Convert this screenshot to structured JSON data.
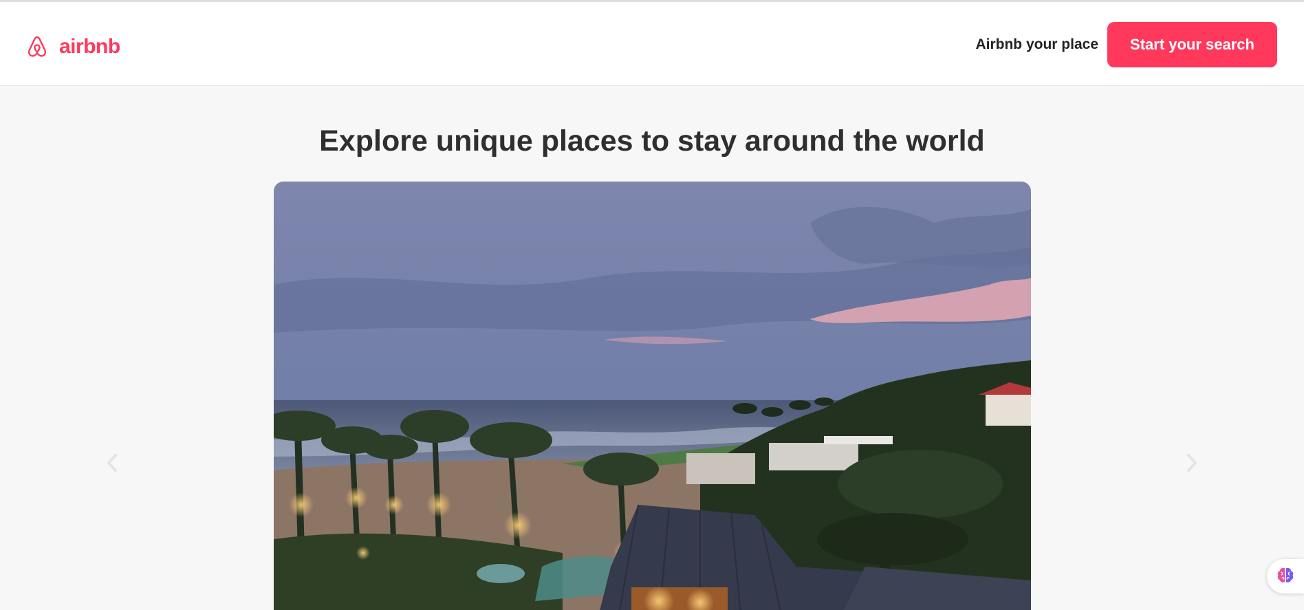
{
  "header": {
    "logo_text": "airbnb",
    "host_link": "Airbnb your place",
    "search_button": "Start your search"
  },
  "main": {
    "headline": "Explore unique places to stay around the world"
  },
  "icons": {
    "logo": "airbnb-belo-icon",
    "prev": "chevron-left-icon",
    "next": "chevron-right-icon",
    "assistant": "brain-icon"
  },
  "colors": {
    "brand": "#ff385c",
    "text": "#222222",
    "background": "#f7f7f7"
  }
}
